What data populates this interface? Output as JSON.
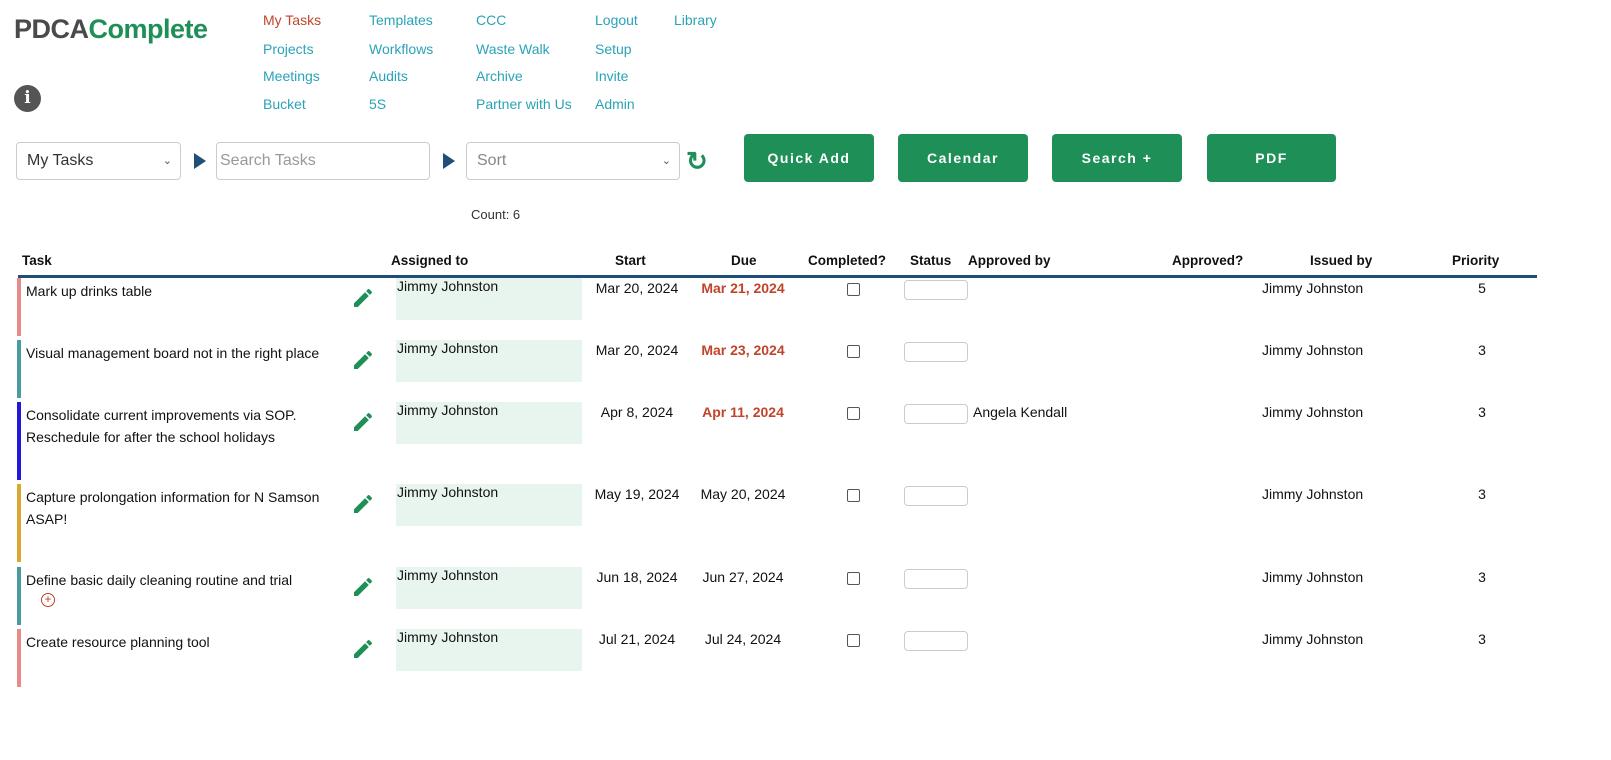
{
  "logo": {
    "part1": "PDCA",
    "part2": "Complete"
  },
  "nav": [
    {
      "label": "My Tasks",
      "active": true
    },
    {
      "label": "Projects"
    },
    {
      "label": "Meetings"
    },
    {
      "label": "Bucket"
    },
    {
      "label": "Templates"
    },
    {
      "label": "Workflows"
    },
    {
      "label": "Audits"
    },
    {
      "label": "5S"
    },
    {
      "label": "CCC"
    },
    {
      "label": "Waste Walk"
    },
    {
      "label": "Archive"
    },
    {
      "label": "Partner with Us"
    },
    {
      "label": "Logout"
    },
    {
      "label": "Setup"
    },
    {
      "label": "Invite"
    },
    {
      "label": "Admin"
    },
    {
      "label": "Library"
    }
  ],
  "toolbar": {
    "view_select": "My Tasks",
    "search_placeholder": "Search Tasks",
    "sort_placeholder": "Sort",
    "quick_add": "Quick Add",
    "calendar": "Calendar",
    "search_plus": "Search +",
    "pdf": "PDF",
    "count": "Count: 6"
  },
  "colors": {
    "accent": "#1e8f57",
    "link": "#2aa3b8",
    "overdue": "#c0442a",
    "header_line": "#1f4e79"
  },
  "table": {
    "headers": [
      "Task",
      "Assigned to",
      "Start",
      "Due",
      "Completed?",
      "Status",
      "Approved by",
      "Approved?",
      "Issued by",
      "Priority"
    ],
    "rows": [
      {
        "task": "Mark up drinks table",
        "assigned": "Jimmy Johnston",
        "start": "Mar 20, 2024",
        "due": "Mar 21, 2024",
        "overdue": true,
        "completed": false,
        "approved_by": "",
        "issued_by": "Jimmy Johnston",
        "priority": "5",
        "color": "#e88a8a"
      },
      {
        "task": "Visual management board not in the right place",
        "assigned": "Jimmy Johnston",
        "start": "Mar 20, 2024",
        "due": "Mar 23, 2024",
        "overdue": true,
        "completed": false,
        "approved_by": "",
        "issued_by": "Jimmy Johnston",
        "priority": "3",
        "color": "#4a9aa0"
      },
      {
        "task": "Consolidate current improvements via SOP. Reschedule for after the school holidays",
        "assigned": "Jimmy Johnston",
        "start": "Apr 8, 2024",
        "due": "Apr 11, 2024",
        "overdue": true,
        "completed": false,
        "approved_by": "Angela Kendall",
        "issued_by": "Jimmy Johnston",
        "priority": "3",
        "color": "#2418d8"
      },
      {
        "task": "Capture prolongation information for N Samson ASAP!",
        "assigned": "Jimmy Johnston",
        "start": "May 19, 2024",
        "due": "May 20, 2024",
        "overdue": false,
        "completed": false,
        "approved_by": "",
        "issued_by": "Jimmy Johnston",
        "priority": "3",
        "color": "#d8a830"
      },
      {
        "task": "Define basic daily cleaning routine and trial",
        "assigned": "Jimmy Johnston",
        "start": "Jun 18, 2024",
        "due": "Jun 27, 2024",
        "overdue": false,
        "completed": false,
        "approved_by": "",
        "issued_by": "Jimmy Johnston",
        "priority": "3",
        "color": "#4a9aa0",
        "has_subtask_icon": true
      },
      {
        "task": "Create resource planning tool",
        "assigned": "Jimmy Johnston",
        "start": "Jul 21, 2024",
        "due": "Jul 24, 2024",
        "overdue": false,
        "completed": false,
        "approved_by": "",
        "issued_by": "Jimmy Johnston",
        "priority": "3",
        "color": "#e88a8a"
      }
    ]
  }
}
